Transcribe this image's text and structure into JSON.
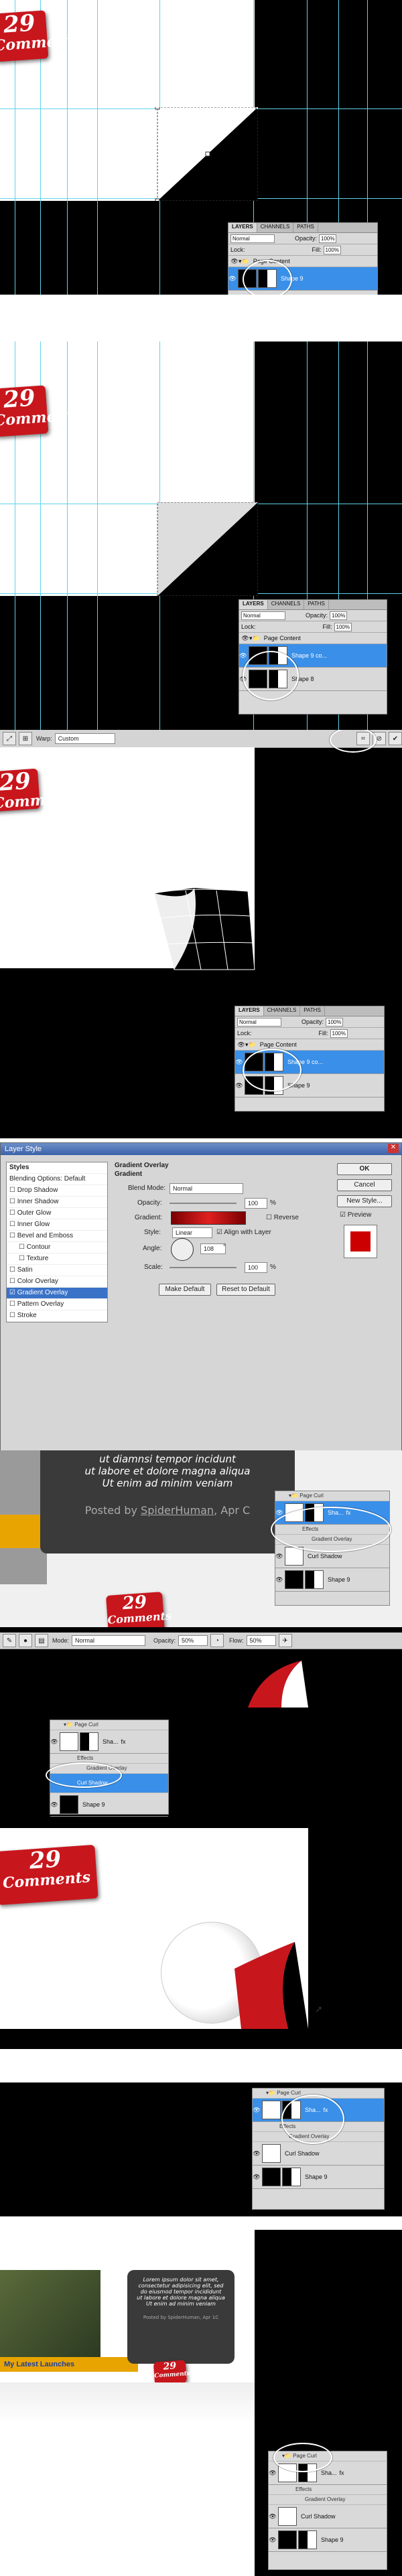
{
  "badge": {
    "number": "29",
    "label": "Comments"
  },
  "layers_panel": {
    "tabs": [
      "LAYERS",
      "CHANNELS",
      "PATHS"
    ],
    "blend_mode": "Normal",
    "opacity_label": "Opacity:",
    "opacity": "100%",
    "lock_label": "Lock:",
    "fill_label": "Fill:",
    "fill": "100%",
    "group": "Page Content",
    "shape9": "Shape 9",
    "shape9_copy": "Shape 9 co...",
    "shape8": "Shape 8"
  },
  "warp_bar": {
    "label": "Warp:",
    "value": "Custom"
  },
  "layer_style": {
    "title": "Layer Style",
    "styles": [
      "Styles",
      "Blending Options: Default",
      "Drop Shadow",
      "Inner Shadow",
      "Outer Glow",
      "Inner Glow",
      "Bevel and Emboss",
      "Contour",
      "Texture",
      "Satin",
      "Color Overlay",
      "Gradient Overlay",
      "Pattern Overlay",
      "Stroke"
    ],
    "section": "Gradient Overlay",
    "group_label": "Gradient",
    "blend_label": "Blend Mode:",
    "blend_value": "Normal",
    "opacity_label": "Opacity:",
    "opacity_value": "100",
    "pct": "%",
    "gradient_label": "Gradient:",
    "reverse": "Reverse",
    "style_label": "Style:",
    "style_value": "Linear",
    "align": "Align with Layer",
    "angle_label": "Angle:",
    "angle_value": "108",
    "deg": "°",
    "scale_label": "Scale:",
    "scale_value": "100",
    "make_default": "Make Default",
    "reset_default": "Reset to Default",
    "ok": "OK",
    "cancel": "Cancel",
    "new_style": "New Style...",
    "preview": "Preview"
  },
  "comment": {
    "line1": "ut diamnsi tempor incidunt",
    "line2": "ut labore et dolore magna aliqua",
    "line3": "Ut enim ad minim veniam",
    "posted": "Posted by",
    "author": "SpiderHuman",
    "date": "Apr C",
    "small1": "Lorem ipsum dolor sit amet,",
    "small2": "consectetur adipisicing elit, sed",
    "small3": "do eiusmod tempor incididunt",
    "small4": "ut labore et dolore magna aliqua",
    "small5": "Ut enim ad minim veniam",
    "small_posted": "Posted by SpiderHuman, Apr 1C",
    "latest": "My Latest Launches"
  },
  "fx_panel": {
    "group": "Page Curl",
    "sha": "Sha...",
    "fx": "fx",
    "effects": "Effects",
    "gradient_overlay": "Gradient Overlay",
    "curl_shadow": "Curl Shadow",
    "shape9": "Shape 9"
  },
  "brush_bar": {
    "mode_label": "Mode:",
    "mode_value": "Normal",
    "opacity_label": "Opacity:",
    "opacity_value": "50%",
    "flow_label": "Flow:",
    "flow_value": "50%"
  }
}
